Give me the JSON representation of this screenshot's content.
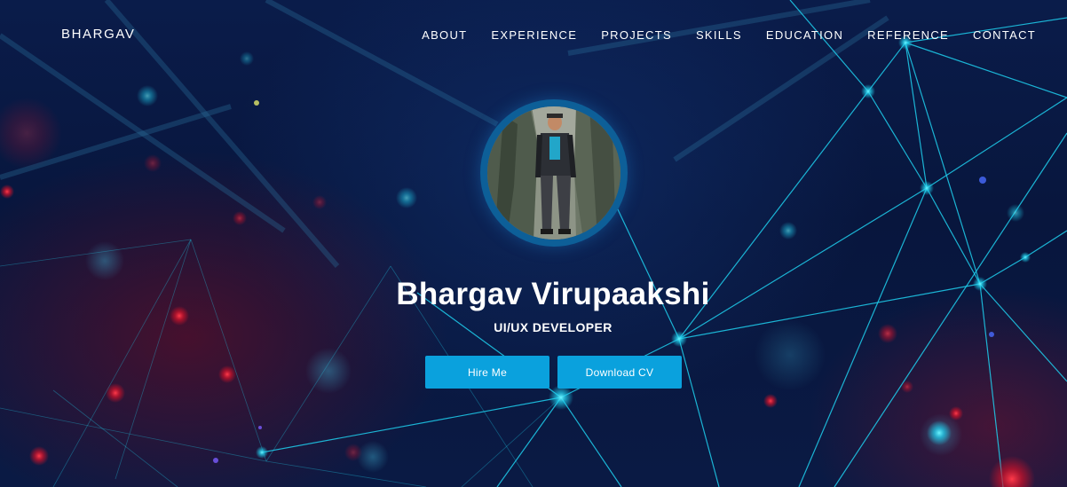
{
  "navbar": {
    "brand": "BHARGAV",
    "links": [
      {
        "label": "ABOUT"
      },
      {
        "label": "EXPERIENCE"
      },
      {
        "label": "PROJECTS"
      },
      {
        "label": "SKILLS"
      },
      {
        "label": "EDUCATION"
      },
      {
        "label": "REFERENCE"
      },
      {
        "label": "CONTACT"
      }
    ]
  },
  "hero": {
    "name": "Bhargav Virupaakshi",
    "role": "UI/UX DEVELOPER",
    "buttons": {
      "hire": "Hire Me",
      "download_cv": "Download CV"
    },
    "avatar_alt": "profile-photo"
  },
  "colors": {
    "background": "#08163d",
    "accent_button": "#0aa1dd",
    "avatar_ring": "#0d5f98",
    "network_lines": "#1fd0ee",
    "bokeh_red": "#e0142c"
  }
}
